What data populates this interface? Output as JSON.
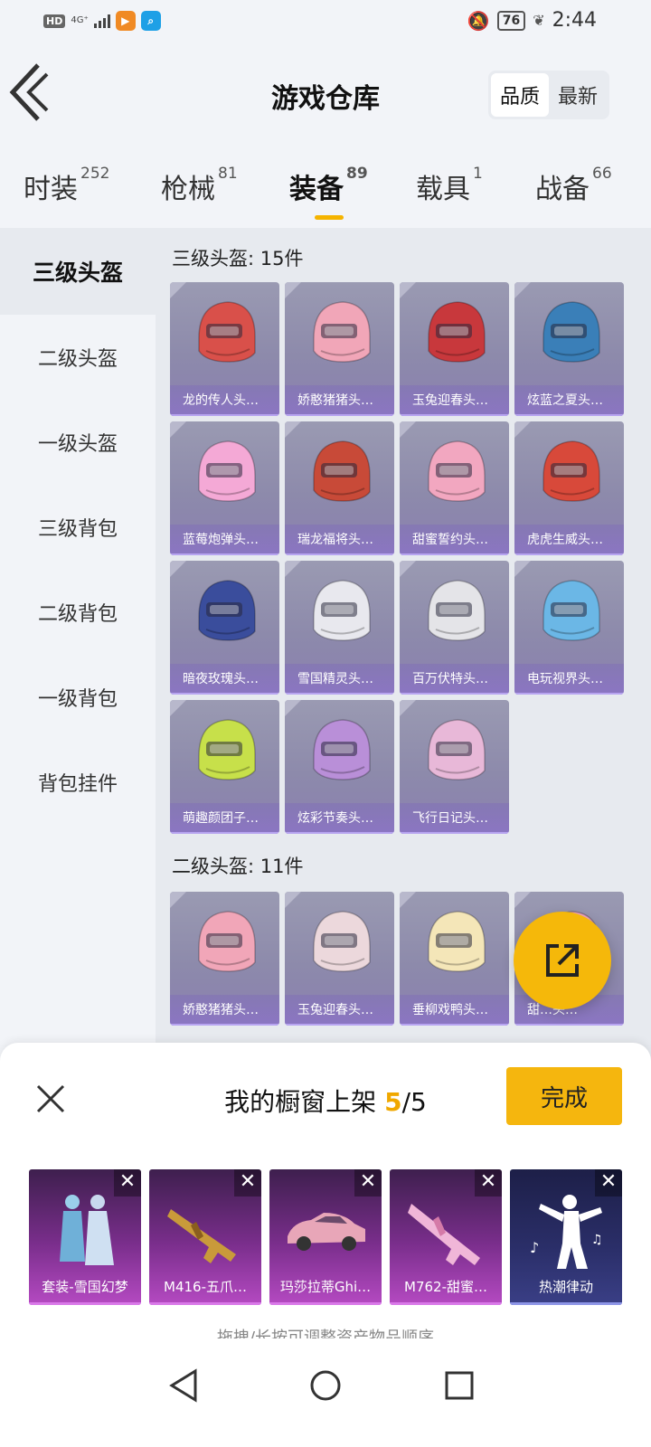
{
  "status_bar": {
    "hd": "HD",
    "network": "4G⁺",
    "battery": "76",
    "time": "2:44"
  },
  "header": {
    "title": "游戏仓库",
    "sort_options": [
      "品质",
      "最新"
    ]
  },
  "tabs": [
    {
      "label": "时装",
      "count": "252"
    },
    {
      "label": "枪械",
      "count": "81"
    },
    {
      "label": "装备",
      "count": "89"
    },
    {
      "label": "载具",
      "count": "1"
    },
    {
      "label": "战备",
      "count": "66"
    }
  ],
  "sidebar": {
    "items": [
      "三级头盔",
      "二级头盔",
      "一级头盔",
      "三级背包",
      "二级背包",
      "一级背包",
      "背包挂件"
    ]
  },
  "sections": [
    {
      "title": "三级头盔: 15件",
      "items": [
        {
          "label": "龙的传人头…",
          "color": "#d9504a"
        },
        {
          "label": "娇憨猪猪头…",
          "color": "#f1a6b8"
        },
        {
          "label": "玉兔迎春头…",
          "color": "#c8383c"
        },
        {
          "label": "炫蓝之夏头…",
          "color": "#3a7fb8"
        },
        {
          "label": "蓝莓炮弹头…",
          "color": "#f4a9d6"
        },
        {
          "label": "瑞龙福将头…",
          "color": "#c84a38"
        },
        {
          "label": "甜蜜誓约头…",
          "color": "#f2a7c0"
        },
        {
          "label": "虎虎生威头…",
          "color": "#d8493a"
        },
        {
          "label": "暗夜玫瑰头…",
          "color": "#3a4d9c"
        },
        {
          "label": "雪国精灵头…",
          "color": "#e8e8ee"
        },
        {
          "label": "百万伏特头…",
          "color": "#e4e4e8"
        },
        {
          "label": "电玩视界头…",
          "color": "#6bb7e6"
        },
        {
          "label": "萌趣颜团子…",
          "color": "#c7e04a"
        },
        {
          "label": "炫彩节奏头…",
          "color": "#b98fd8"
        },
        {
          "label": "飞行日记头…",
          "color": "#e8b8d8"
        }
      ]
    },
    {
      "title": "二级头盔: 11件",
      "items": [
        {
          "label": "娇憨猪猪头…",
          "color": "#f1a6b8"
        },
        {
          "label": "玉兔迎春头…",
          "color": "#ecd8dc"
        },
        {
          "label": "垂柳戏鸭头…",
          "color": "#f4e6b8"
        },
        {
          "label": "甜…头…",
          "color": "#f2a7c0"
        }
      ]
    }
  ],
  "showcase": {
    "title_prefix": "我的橱窗上架",
    "count_current": "5",
    "count_total": "/5",
    "done_label": "完成",
    "close_glyph": "✕",
    "items": [
      {
        "label": "套装-雪国幻梦",
        "icon": "outfit-icon"
      },
      {
        "label": "M416-五爪…",
        "icon": "rifle-icon"
      },
      {
        "label": "玛莎拉蒂Ghi…",
        "icon": "car-icon"
      },
      {
        "label": "M762-甜蜜…",
        "icon": "rifle-icon"
      },
      {
        "label": "热潮律动",
        "icon": "dance-icon"
      }
    ],
    "hint": "拖拽/长按可调整资产物品顺序"
  }
}
